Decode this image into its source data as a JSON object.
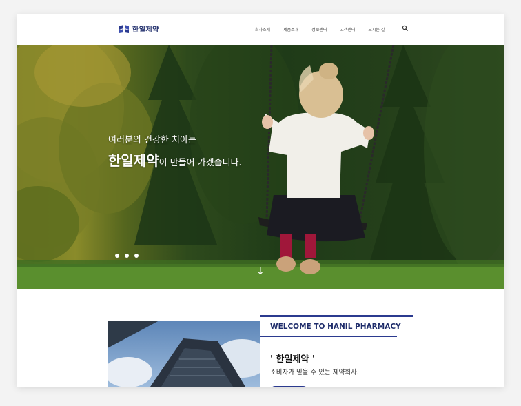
{
  "header": {
    "logo_text": "한일제약",
    "nav": [
      "회사소개",
      "제품소개",
      "정보센터",
      "고객센터",
      "오시는 길"
    ]
  },
  "hero": {
    "line1": "여러분의 건강한 치아는",
    "line2_strong": "한일제약",
    "line2_rest": "이 만들어 가겠습니다.",
    "arrow": "↓"
  },
  "welcome": {
    "title": "WELCOME TO HANIL PHARMACY",
    "company": "' 한일제약 '",
    "tagline": "소비자가 믿을 수 있는 제약회사."
  },
  "colors": {
    "brand": "#2b3a8f",
    "brand_text": "#1f2d6b"
  }
}
